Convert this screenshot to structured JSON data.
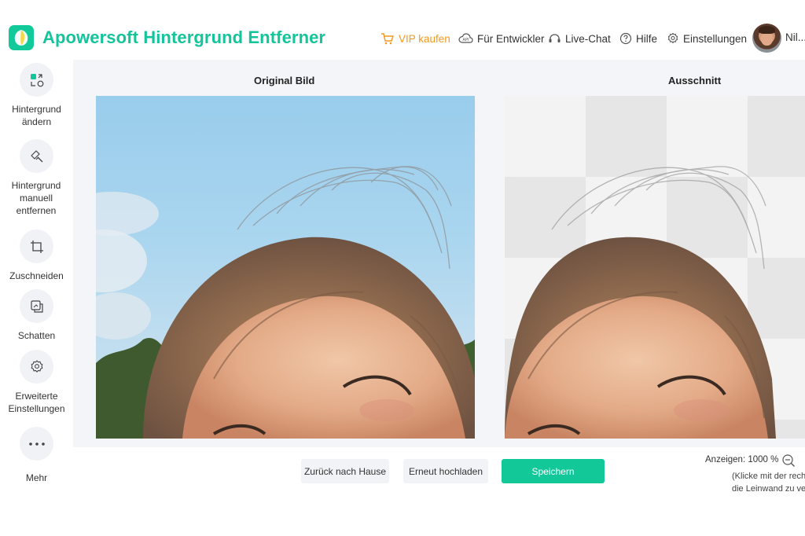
{
  "header": {
    "app_title": "Apowersoft Hintergrund Entferner",
    "nav": {
      "vip": "VIP kaufen",
      "developer": "Für Entwickler",
      "chat": "Live-Chat",
      "help": "Hilfe",
      "settings": "Einstellungen"
    },
    "user_name": "Nil..."
  },
  "sidebar": {
    "items": [
      {
        "label": "Hintergrund ändern",
        "icon": "change-background-icon"
      },
      {
        "label": "Hintergrund manuell entfernen",
        "icon": "manual-erase-icon"
      },
      {
        "label": "Zuschneiden",
        "icon": "crop-icon"
      },
      {
        "label": "Schatten",
        "icon": "shadow-icon"
      },
      {
        "label": "Erweiterte Einstellungen",
        "icon": "advanced-settings-icon"
      },
      {
        "label": "Mehr",
        "icon": "more-icon"
      }
    ]
  },
  "main": {
    "original_title": "Original Bild",
    "cutout_title": "Ausschnitt"
  },
  "footer": {
    "home_button": "Zurück nach Hause",
    "reupload_button": "Erneut hochladen",
    "save_button": "Speichern",
    "zoom_label": "Anzeigen: 1000 %",
    "zoom_hint_line1": "(Klicke mit der rech",
    "zoom_hint_line2": "die Leinwand zu ve"
  },
  "colors": {
    "brand": "#14c49a",
    "vip": "#f39a1e",
    "panel_bg": "#f4f5f9"
  }
}
